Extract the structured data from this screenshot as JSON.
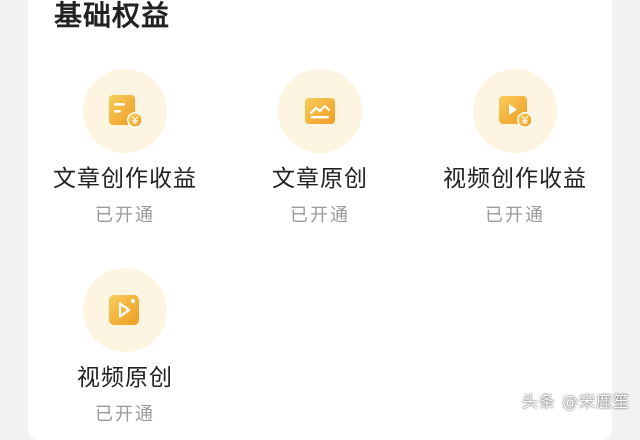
{
  "section": {
    "title": "基础权益"
  },
  "benefits": [
    {
      "label": "文章创作收益",
      "status": "已开通",
      "icon": "article-revenue-icon"
    },
    {
      "label": "文章原创",
      "status": "已开通",
      "icon": "article-original-icon"
    },
    {
      "label": "视频创作收益",
      "status": "已开通",
      "icon": "video-revenue-icon"
    },
    {
      "label": "视频原创",
      "status": "已开通",
      "icon": "video-original-icon"
    }
  ],
  "watermark": "头条 @宋鹿笙",
  "colors": {
    "icon_bg": "#fdf4e1",
    "icon_gold_light": "#f8cd5a",
    "icon_gold_dark": "#ee9c24",
    "text_primary": "#222222",
    "text_secondary": "#9a9a9a"
  }
}
